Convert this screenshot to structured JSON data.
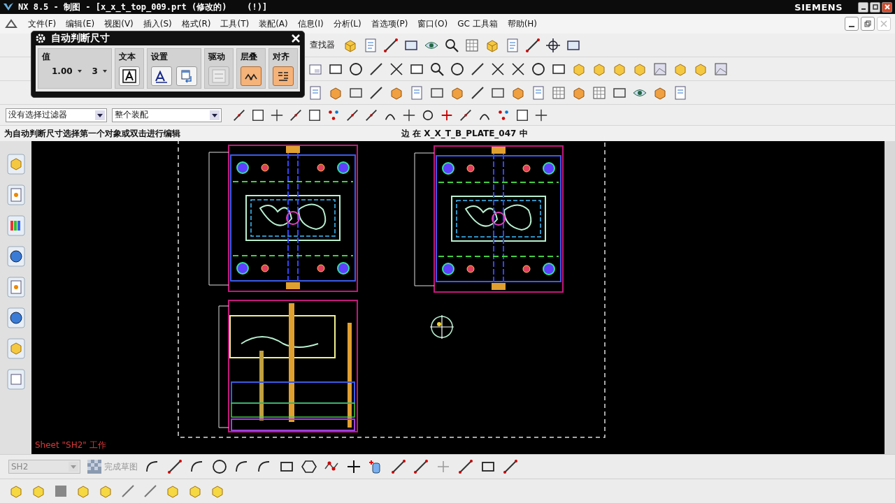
{
  "window": {
    "title": "NX 8.5 - 制图 - [x_x_t_top_009.prt (修改的)    (!)]",
    "brand": "SIEMENS"
  },
  "menu": [
    "文件(F)",
    "编辑(E)",
    "视图(V)",
    "插入(S)",
    "格式(R)",
    "工具(T)",
    "装配(A)",
    "信息(I)",
    "分析(L)",
    "首选项(P)",
    "窗口(O)",
    "GC 工具箱",
    "帮助(H)"
  ],
  "dialog": {
    "title": "自动判断尺寸",
    "groups": [
      {
        "kind": "value",
        "label": "值",
        "value": "1.00",
        "precision": "3"
      },
      {
        "kind": "text",
        "label": "文本",
        "disabled": false,
        "on": false
      },
      {
        "kind": "settings",
        "label": "设置",
        "disabled": false,
        "on": false
      },
      {
        "kind": "driving",
        "label": "驱动",
        "disabled": true,
        "on": false
      },
      {
        "kind": "stack",
        "label": "层叠",
        "disabled": false,
        "on": true
      },
      {
        "kind": "align",
        "label": "对齐",
        "disabled": false,
        "on": true
      }
    ]
  },
  "toolbar": {
    "finder": "查找器"
  },
  "filters": [
    {
      "value": "没有选择过滤器"
    },
    {
      "value": "整个装配"
    }
  ],
  "status": {
    "prompt": "为自动判断尺寸选择第一个对象或双击进行编辑",
    "info": "边 在 X_X_T_B_PLATE_047 中"
  },
  "canvas": {
    "sheet_label": "Sheet \"SH2\" 工作"
  },
  "sketch_bar": {
    "sheet": "SH2",
    "sheet_disabled": true,
    "finish": "完成草图",
    "finish_disabled": true
  }
}
